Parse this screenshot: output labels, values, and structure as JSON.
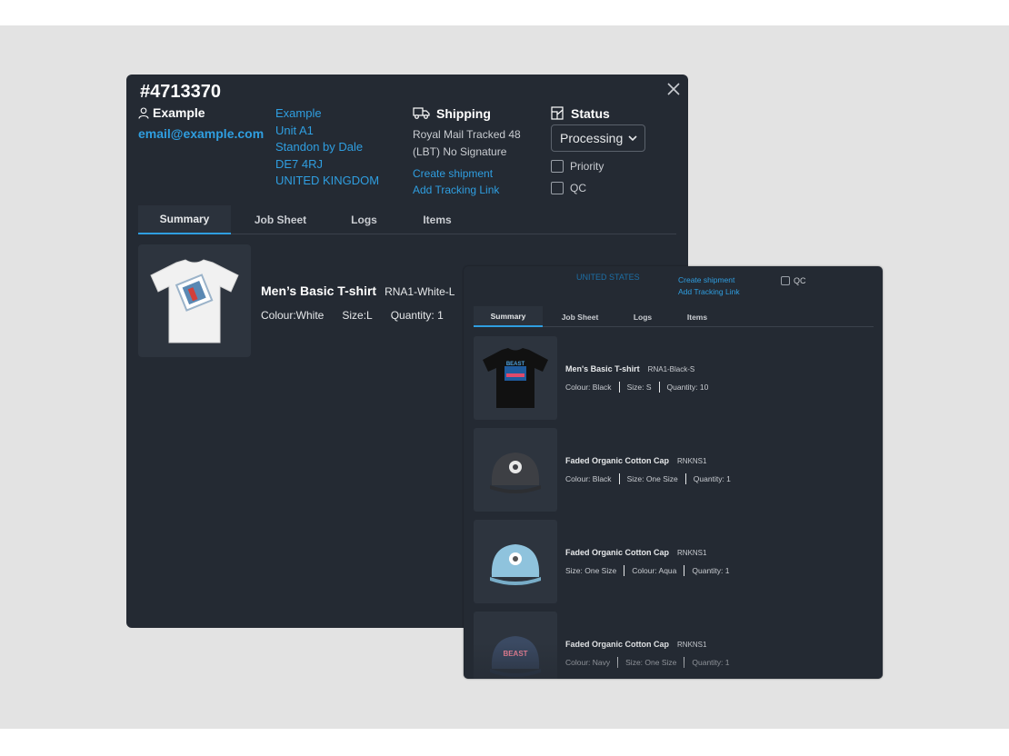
{
  "order": {
    "number": "#4713370",
    "customer": {
      "name": "Example",
      "email": "email@example.com"
    },
    "address": [
      "Example",
      "Unit A1",
      "Standon by Dale",
      "DE7 4RJ",
      "UNITED KINGDOM"
    ],
    "shipping": {
      "heading": "Shipping",
      "method_line1": "Royal Mail Tracked 48",
      "method_line2": "(LBT) No Signature",
      "create_shipment": "Create shipment",
      "add_tracking": "Add Tracking Link"
    },
    "status": {
      "heading": "Status",
      "selected": "Processing",
      "priority_label": "Priority",
      "qc_label": "QC"
    },
    "tabs": [
      "Summary",
      "Job Sheet",
      "Logs",
      "Items"
    ],
    "item": {
      "title": "Men’s Basic T-shirt",
      "sku": "RNA1-White-L",
      "colour": "Colour:White",
      "size": "Size:L",
      "quantity": "Quantity: 1"
    }
  },
  "overlay": {
    "country": "UNITED STATES",
    "create_shipment": "Create shipment",
    "add_tracking": "Add Tracking Link",
    "qc_label": "QC",
    "tabs": [
      "Summary",
      "Job Sheet",
      "Logs",
      "Items"
    ],
    "items": [
      {
        "title": "Men's Basic T-shirt",
        "sku": "RNA1-Black-S",
        "attrs": [
          "Colour: Black",
          "Size: S",
          "Quantity: 10"
        ],
        "thumb_color": "#111111",
        "thumb_text": "BEAST"
      },
      {
        "title": "Faded Organic Cotton Cap",
        "sku": "RNKNS1",
        "attrs": [
          "Colour: Black",
          "Size: One Size",
          "Quantity: 1"
        ],
        "thumb_color": "#3d3f44"
      },
      {
        "title": "Faded Organic Cotton Cap",
        "sku": "RNKNS1",
        "attrs": [
          "Size: One Size",
          "Colour: Aqua",
          "Quantity: 1"
        ],
        "thumb_color": "#8fc3dd"
      },
      {
        "title": "Faded Organic Cotton Cap",
        "sku": "RNKNS1",
        "attrs": [
          "Colour: Navy",
          "Size: One Size",
          "Quantity: 1"
        ],
        "thumb_color": "#3b4a63",
        "thumb_text": "BEAST"
      }
    ]
  },
  "colors": {
    "panel_bg": "#242a33",
    "accent": "#2f9ee0",
    "page_bg": "#e3e3e3"
  }
}
